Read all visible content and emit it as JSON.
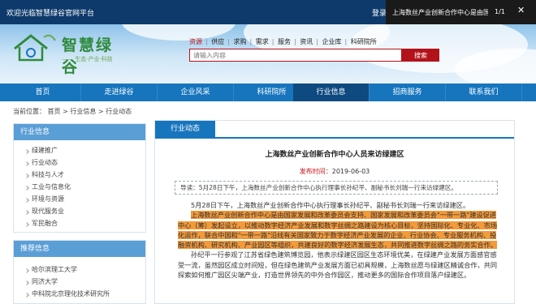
{
  "topbar": {
    "welcome": "欢迎光临智慧绿谷官网平台",
    "login": "登录"
  },
  "tooltip": {
    "title": "上海数丝产业创新合作中心是由国",
    "page": "1/1",
    "close": "✕"
  },
  "logo": {
    "text": "智慧绿谷",
    "sub": "—— 生态·产业·科技 ——"
  },
  "header_links": [
    "资源",
    "供应",
    "求购",
    "需求",
    "服务",
    "资讯",
    "企业库",
    "科研院所"
  ],
  "search": {
    "placeholder": "请输入内容",
    "button": "搜索"
  },
  "nav": [
    "首页",
    "走进绿谷",
    "企业风采",
    "科研院所",
    "行业信息",
    "招商服务",
    "联系我们"
  ],
  "nav_active": "行业信息",
  "breadcrumb": "当前位置：  首页 > 行业信息 > 行业动态",
  "sidebar": {
    "industry": {
      "title": "行业信息",
      "items": [
        "绿建推广",
        "行业动态",
        "科技与人才",
        "工业与信息化",
        "环境与资源",
        "现代服务业",
        "军民融合"
      ]
    },
    "recommend": {
      "title": "推荐信息",
      "items": [
        "哈尔滨理工大学",
        "同济大学",
        "中科院北京理化技术研究所"
      ]
    }
  },
  "main": {
    "tab": "行业动态",
    "title": "上海数丝产业创新合作中心人员来访绿建区",
    "date_label": "发布时间：",
    "date": "2019-06-03",
    "summary": "导读：5月28日下午，上海数丝产业创新合作中心执行理事长孙纪平、副秘书长刘瑞一行来访绿建区。",
    "paragraph1": "5月28日下午，上海数丝产业创新合作中心执行理事长孙纪平、副秘书长刘瑞一行来访绿建区。",
    "highlight": "上海数丝产业创新合作中心是由国家发展和改革委员会支持、国家发展和改革委员会\"一带一路\"建设促进中心（筹）发起设立，以推动数字经济产业发展和数字丝绸之路建设为核心目标，坚持国际化、专业化、市场化运作，联合中国和\"一带一路\"沿线有关国家致力于数字经济产业发展的企业、行业协会、专业服务机构、投融资机构、研究机构、产业园区等组织，共建良好的数字经济发展生态，共同推进数字丝绸之路的务实合作。",
    "paragraph2": "孙纪平一行参观了江苏省绿色建筑博览园，他表示绿建区园区生态环境优美，在绿建产业发展方面感官感受一流，虽然园区成立时间短，但在绿色建筑产业发展方面已初具规模，上海数丝愿与绿建区精诚合作，共同探索如何推广园区尖端产业，打造世界领先的中外合作园区，推动更多的国际合作项目落户绿建区。"
  },
  "colors": {
    "topbar": "#0e3a6b",
    "nav": "#1675bd",
    "nav_active": "#0e4a80",
    "accent_red": "#b4121a",
    "highlight": "#f39a3a",
    "sidebar_head": "#5a9ed6"
  }
}
